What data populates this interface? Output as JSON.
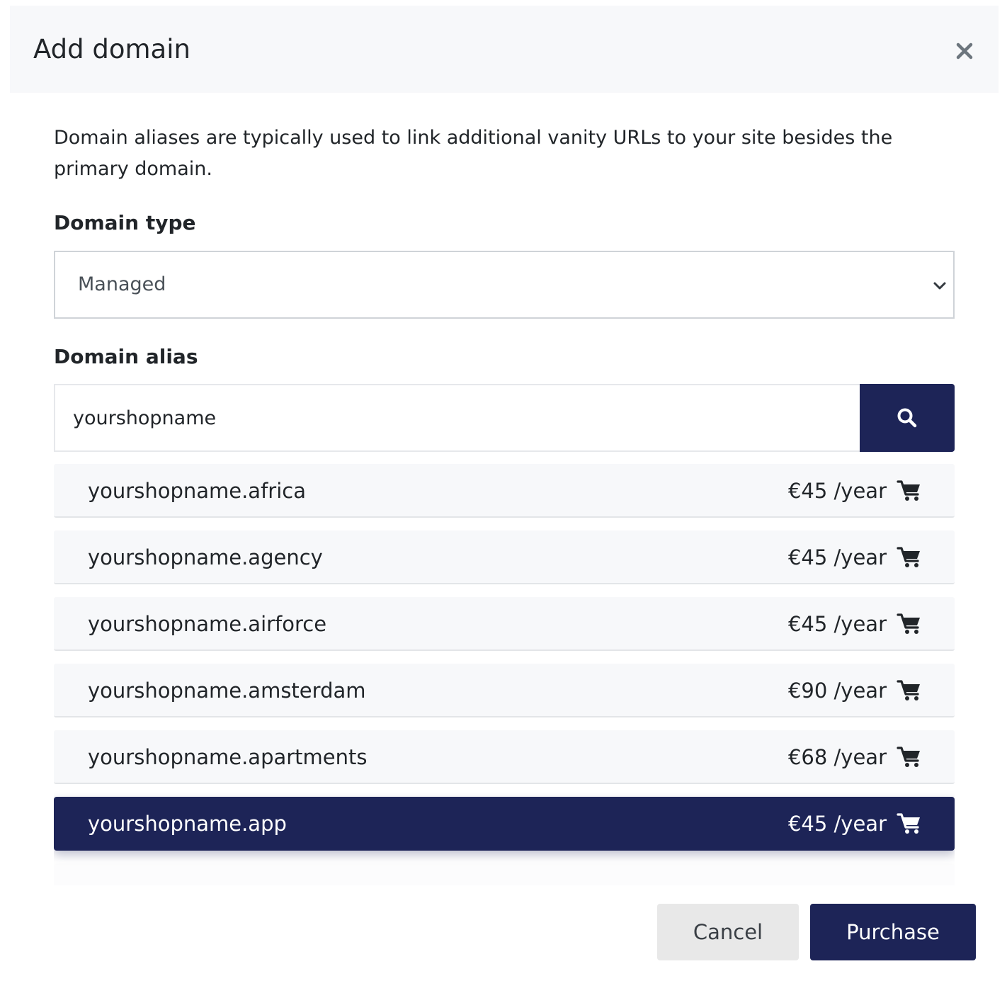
{
  "modal": {
    "title": "Add domain",
    "description": "Domain aliases are typically used to link additional vanity URLs to your site besides the primary domain."
  },
  "domain_type": {
    "label": "Domain type",
    "selected": "Managed"
  },
  "domain_alias": {
    "label": "Domain alias",
    "value": "yourshopname"
  },
  "results": [
    {
      "name": "yourshopname.africa",
      "price": "€45 /year",
      "selected": false
    },
    {
      "name": "yourshopname.agency",
      "price": "€45 /year",
      "selected": false
    },
    {
      "name": "yourshopname.airforce",
      "price": "€45 /year",
      "selected": false
    },
    {
      "name": "yourshopname.amsterdam",
      "price": "€90 /year",
      "selected": false
    },
    {
      "name": "yourshopname.apartments",
      "price": "€68 /year",
      "selected": false
    },
    {
      "name": "yourshopname.app",
      "price": "€45 /year",
      "selected": true
    }
  ],
  "footer": {
    "cancel_label": "Cancel",
    "purchase_label": "Purchase"
  },
  "colors": {
    "primary": "#1d2457",
    "header_bg": "#f7f8fa",
    "row_bg": "#f7f8fa",
    "cancel_bg": "#e8e8e8"
  },
  "icons": {
    "close": "close-icon",
    "chevron": "chevron-down-icon",
    "search": "search-icon",
    "cart": "shopping-cart-icon"
  }
}
